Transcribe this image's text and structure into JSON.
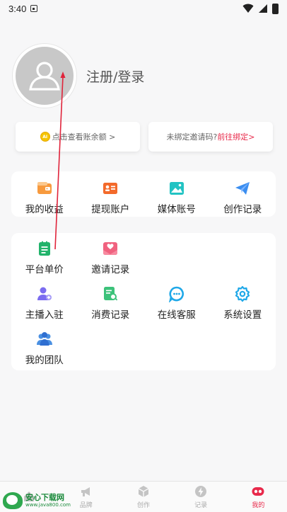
{
  "status_bar": {
    "time": "3:40"
  },
  "profile": {
    "login_label": "注册/登录"
  },
  "balance_card": {
    "coin_icon": "coin-icon",
    "text": "点击查看账余额 >"
  },
  "invite_card": {
    "prefix": "未绑定邀请码?",
    "link": "前往绑定>"
  },
  "colors": {
    "accent": "#e8294a",
    "brand_green": "#2fa84f"
  },
  "panel1": {
    "items": [
      {
        "label": "我的收益",
        "icon": "wallet-icon"
      },
      {
        "label": "提现账户",
        "icon": "id-card-icon"
      },
      {
        "label": "媒体账号",
        "icon": "image-icon"
      },
      {
        "label": "创作记录",
        "icon": "paper-plane-icon"
      }
    ]
  },
  "panel2": {
    "items": [
      {
        "label": "平台单价",
        "icon": "clipboard-icon"
      },
      {
        "label": "邀请记录",
        "icon": "heart-envelope-icon"
      },
      {
        "label": "主播入驻",
        "icon": "user-add-icon"
      },
      {
        "label": "消费记录",
        "icon": "receipt-search-icon"
      },
      {
        "label": "在线客服",
        "icon": "chat-icon"
      },
      {
        "label": "系统设置",
        "icon": "gear-icon"
      },
      {
        "label": "我的团队",
        "icon": "team-icon"
      }
    ]
  },
  "bottom_nav": {
    "items": [
      {
        "label": "",
        "icon": "home-icon"
      },
      {
        "label": "品牌",
        "icon": "megaphone-icon"
      },
      {
        "label": "创作",
        "icon": "cube-icon"
      },
      {
        "label": "记录",
        "icon": "bolt-icon"
      },
      {
        "label": "我的",
        "icon": "profile-icon",
        "active": true
      }
    ]
  },
  "watermark": {
    "title": "安心下载网",
    "url": "www.java800.com"
  }
}
